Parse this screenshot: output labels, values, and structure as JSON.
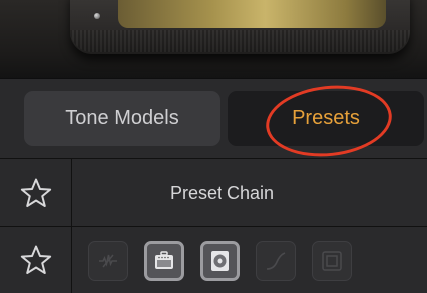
{
  "tabs": [
    {
      "label": "Tone Models",
      "selected": false
    },
    {
      "label": "Presets",
      "selected": true
    }
  ],
  "colors": {
    "accent": "#e7a13a",
    "highlight": "#e23b24"
  },
  "header_row": {
    "title": "Preset Chain",
    "star_icon": "star-outline-icon"
  },
  "chain_row": {
    "star_icon": "star-outline-icon",
    "modules": [
      {
        "icon": "noise-gate-icon",
        "active": false
      },
      {
        "icon": "amp-icon",
        "active": true
      },
      {
        "icon": "cabinet-icon",
        "active": true
      },
      {
        "icon": "eq-curve-icon",
        "active": false
      },
      {
        "icon": "reverb-icon",
        "active": false
      }
    ]
  }
}
